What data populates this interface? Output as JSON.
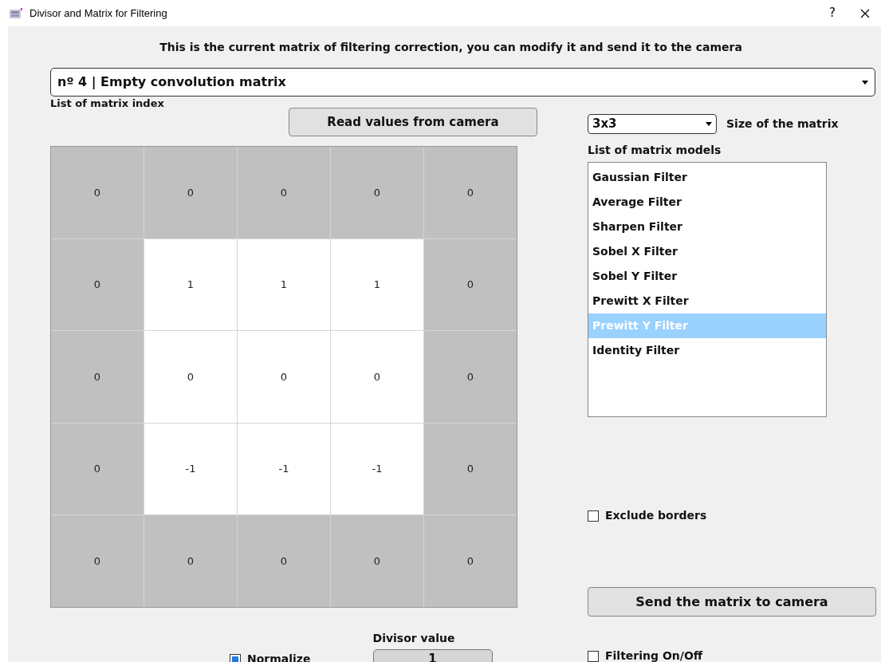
{
  "window": {
    "title": "Divisor and Matrix for Filtering",
    "help": "?"
  },
  "header": "This is the current matrix of filtering correction, you can modify it and send it to the camera",
  "matrix_index": {
    "value": "nº 4 | Empty convolution matrix",
    "label": "List of matrix index"
  },
  "read_button": "Read values from camera",
  "matrix": [
    [
      {
        "value": "0",
        "active": false
      },
      {
        "value": "0",
        "active": false
      },
      {
        "value": "0",
        "active": false
      },
      {
        "value": "0",
        "active": false
      },
      {
        "value": "0",
        "active": false
      }
    ],
    [
      {
        "value": "0",
        "active": false
      },
      {
        "value": "1",
        "active": true
      },
      {
        "value": "1",
        "active": true
      },
      {
        "value": "1",
        "active": true
      },
      {
        "value": "0",
        "active": false
      }
    ],
    [
      {
        "value": "0",
        "active": false
      },
      {
        "value": "0",
        "active": true
      },
      {
        "value": "0",
        "active": true
      },
      {
        "value": "0",
        "active": true
      },
      {
        "value": "0",
        "active": false
      }
    ],
    [
      {
        "value": "0",
        "active": false
      },
      {
        "value": "-1",
        "active": true
      },
      {
        "value": "-1",
        "active": true
      },
      {
        "value": "-1",
        "active": true
      },
      {
        "value": "0",
        "active": false
      }
    ],
    [
      {
        "value": "0",
        "active": false
      },
      {
        "value": "0",
        "active": false
      },
      {
        "value": "0",
        "active": false
      },
      {
        "value": "0",
        "active": false
      },
      {
        "value": "0",
        "active": false
      }
    ]
  ],
  "size": {
    "value": "3x3",
    "label": "Size of the matrix"
  },
  "models": {
    "label": "List of matrix models",
    "items": [
      {
        "label": "Gaussian Filter",
        "selected": false
      },
      {
        "label": "Average Filter",
        "selected": false
      },
      {
        "label": "Sharpen Filter",
        "selected": false
      },
      {
        "label": "Sobel X Filter",
        "selected": false
      },
      {
        "label": "Sobel Y Filter",
        "selected": false
      },
      {
        "label": "Prewitt X Filter",
        "selected": false
      },
      {
        "label": "Prewitt Y Filter",
        "selected": true
      },
      {
        "label": "Identity Filter",
        "selected": false
      }
    ]
  },
  "exclude_borders": {
    "label": "Exclude borders",
    "checked": false
  },
  "send_button": "Send the matrix to camera",
  "normalize": {
    "label": "Normalize",
    "checked": true
  },
  "divisor": {
    "label": "Divisor value",
    "value": "1"
  },
  "filtering": {
    "label": "Filtering On/Off",
    "checked": false
  }
}
